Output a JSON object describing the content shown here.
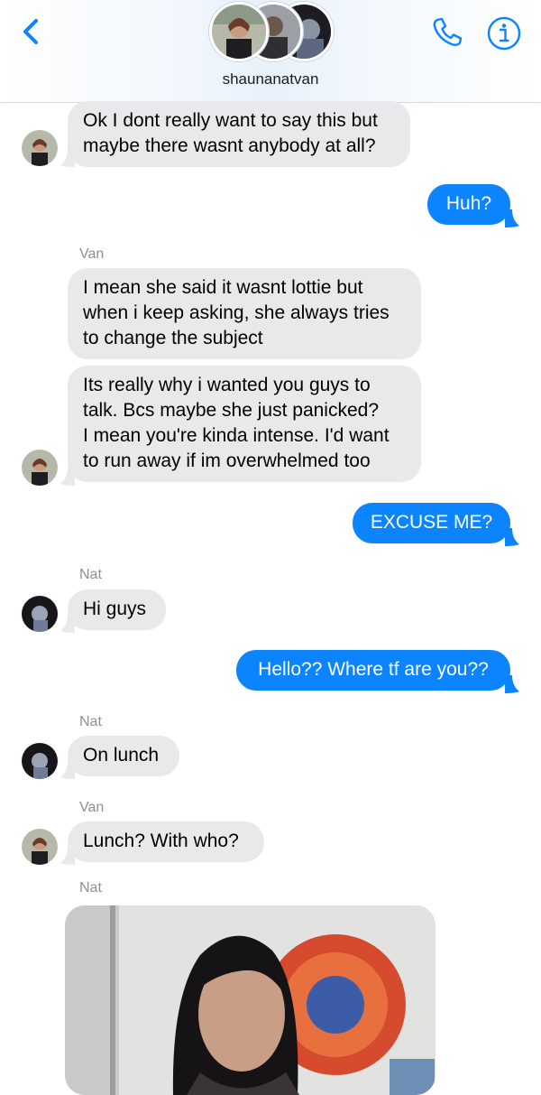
{
  "header": {
    "group_name": "shaunanatvan",
    "back_icon": "chevron-left-icon",
    "call_icon": "phone-icon",
    "info_icon": "info-circle-icon",
    "accent_color": "#0b84fe"
  },
  "senders": {
    "van": "Van",
    "nat": "Nat"
  },
  "messages": {
    "m1": "Ok I dont really want to say this but\nmaybe there wasnt anybody at all?",
    "m2": "Huh?",
    "m3": "I mean she said it wasnt lottie but\nwhen i keep asking, she always tries\nto change the subject",
    "m4": "Its really why i wanted you guys to\ntalk. Bcs maybe she just panicked?\nI mean you're kinda intense. I'd want\nto run away if im overwhelmed too",
    "m5": "EXCUSE ME?",
    "m6": "Hi guys",
    "m7": "Hello?? Where tf are you??",
    "m8": "On lunch",
    "m9": "Lunch? With who?"
  },
  "colors": {
    "incoming_bubble": "#e9e9eb",
    "outgoing_bubble": "#0b84fe"
  }
}
